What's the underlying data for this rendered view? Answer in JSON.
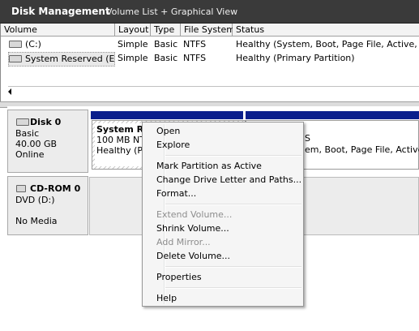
{
  "title": {
    "app": "Disk Management",
    "view": "Volume List + Graphical View"
  },
  "volume_list": {
    "columns": [
      "Volume",
      "Layout",
      "Type",
      "File System",
      "Status"
    ],
    "rows": [
      {
        "volume": "(C:)",
        "layout": "Simple",
        "type": "Basic",
        "fs": "NTFS",
        "status": "Healthy (System, Boot, Page File, Active, Crash"
      },
      {
        "volume": "System Reserved (E:)",
        "layout": "Simple",
        "type": "Basic",
        "fs": "NTFS",
        "status": "Healthy (Primary Partition)"
      }
    ]
  },
  "disks": [
    {
      "name": "Disk 0",
      "kind": "Basic",
      "size": "40.00 GB",
      "state": "Online",
      "volumes": [
        {
          "title": "System R",
          "line1": "100 MB NTF",
          "line2": "Healthy (Pri"
        },
        {
          "line1": "S",
          "line2": "em, Boot, Page File, Active, C"
        }
      ]
    },
    {
      "name": "CD-ROM 0",
      "kind": "DVD (D:)",
      "state": "No Media"
    }
  ],
  "context_menu": {
    "open": "Open",
    "explore": "Explore",
    "mark_active": "Mark Partition as Active",
    "change_letter": "Change Drive Letter and Paths...",
    "format": "Format...",
    "extend": "Extend Volume...",
    "shrink": "Shrink Volume...",
    "add_mirror": "Add Mirror...",
    "delete": "Delete Volume...",
    "properties": "Properties",
    "help": "Help"
  },
  "colors": {
    "primary_partition_bar": "#0a1e8c",
    "highlight": "#ebf514",
    "titlebar": "#3a3a3a"
  }
}
